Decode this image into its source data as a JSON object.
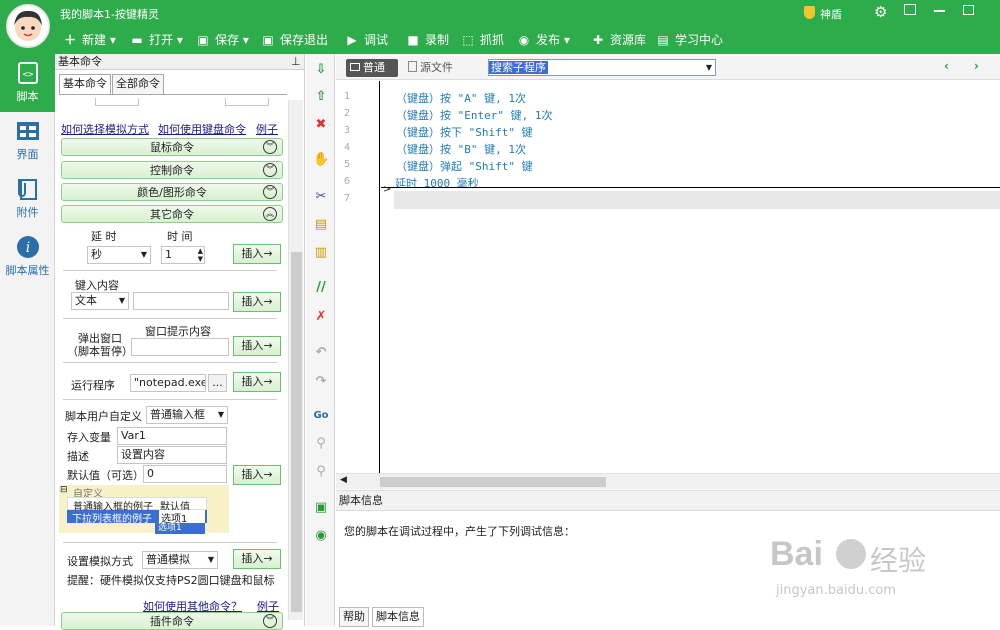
{
  "window": {
    "title": "我的脚本1-按键精灵",
    "shield_label": "神盾"
  },
  "toolbar": {
    "new": "新建",
    "open": "打开",
    "save": "保存",
    "save_exit": "保存退出",
    "debug": "调试",
    "record": "录制",
    "grab": "抓抓",
    "publish": "发布",
    "resources": "资源库",
    "learn": "学习中心"
  },
  "leftnav": [
    {
      "label": "脚本",
      "icon": "script-icon"
    },
    {
      "label": "界面",
      "icon": "interface-icon"
    },
    {
      "label": "附件",
      "icon": "attachment-icon"
    },
    {
      "label": "脚本属性",
      "icon": "info-icon"
    }
  ],
  "panel": {
    "title": "基本命令",
    "tabs": [
      "基本命令",
      "全部命令"
    ],
    "links": {
      "how_select_sim": "如何选择模拟方式",
      "how_keyboard": "如何使用键盘命令",
      "example": "例子",
      "how_other": "如何使用其他命令？",
      "example2": "例子"
    },
    "categories": [
      "鼠标命令",
      "控制命令",
      "颜色/图形命令",
      "其它命令",
      "插件命令"
    ],
    "delay": {
      "label1": "延 时",
      "label2": "时 间",
      "unit": "秒",
      "value": "1",
      "insert": "插入→"
    },
    "key_input": {
      "label": "键入内容",
      "type": "文本",
      "value": "",
      "insert": "插入→"
    },
    "popup": {
      "label": "弹出窗口\n（脚本暂停）",
      "content_label": "窗口提示内容",
      "value": "",
      "insert": "插入→"
    },
    "run": {
      "label": "运行程序",
      "value": "\"notepad.exe\"",
      "browse": "...",
      "insert": "插入→"
    },
    "user_define": {
      "label": "脚本用户自定义",
      "type": "普通输入框",
      "var_label": "存入变量",
      "var_value": "Var1",
      "desc_label": "描述",
      "desc_value": "设置内容",
      "default_label": "默认值（可选）",
      "default_value": "0",
      "insert": "插入→",
      "tree_title": "自定义",
      "row1_name": "普通输入框的例子",
      "row1_value": "默认值",
      "row2_name": "下拉列表框的例子",
      "row2_value": "选项1",
      "dropdown_item": "选项1"
    },
    "sim": {
      "label": "设置模拟方式",
      "type": "普通模拟",
      "insert": "插入→",
      "tip": "提醒：硬件模拟仅支持PS2圆口键盘和鼠标"
    }
  },
  "editor": {
    "tab_normal": "普通",
    "tab_source": "源文件",
    "search_value": "搜索子程序",
    "lines": [
      {
        "n": "1",
        "text": "（键盘）按 \"A\" 键, 1次"
      },
      {
        "n": "2",
        "text": "（键盘）按 \"Enter\" 键, 1次"
      },
      {
        "n": "3",
        "text": "（键盘）按下 \"Shift\" 键"
      },
      {
        "n": "4",
        "text": "（键盘）按 \"B\" 键, 1次"
      },
      {
        "n": "5",
        "text": "（键盘）弹起 \"Shift\" 键"
      },
      {
        "n": "6",
        "text": "延时 1000 毫秒"
      },
      {
        "n": "7",
        "text": ""
      }
    ]
  },
  "info": {
    "title": "脚本信息",
    "message": "您的脚本在调试过程中，产生了下列调试信息：",
    "tabs": [
      "帮助",
      "脚本信息"
    ]
  },
  "watermark": {
    "brand": "Bai",
    "brand2": "经验",
    "url": "jingyan.baidu.com"
  },
  "colors": {
    "accent": "#2eab4a",
    "code": "#1f7bb8"
  }
}
